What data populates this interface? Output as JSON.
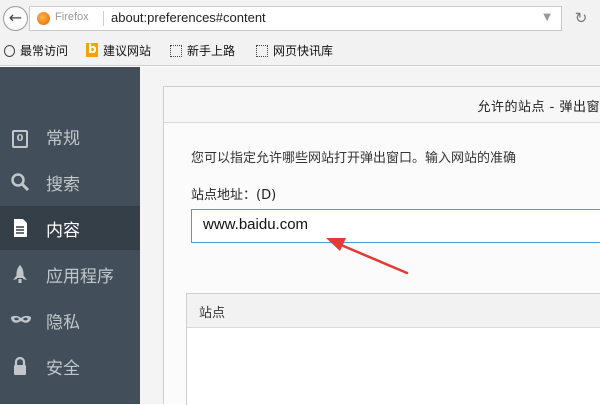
{
  "browser": {
    "brand_label": "Firefox",
    "url": "about:preferences#content"
  },
  "bookmarks": [
    {
      "label": "最常访问",
      "icon": "gear-icon"
    },
    {
      "label": "建议网站",
      "icon": "bing-icon"
    },
    {
      "label": "新手上路",
      "icon": "page-icon"
    },
    {
      "label": "网页快讯库",
      "icon": "page-icon"
    }
  ],
  "sidebar": {
    "items": [
      {
        "label": "常规",
        "icon": "general-icon",
        "selected": false
      },
      {
        "label": "搜索",
        "icon": "search-icon",
        "selected": false
      },
      {
        "label": "内容",
        "icon": "content-icon",
        "selected": true
      },
      {
        "label": "应用程序",
        "icon": "rocket-icon",
        "selected": false
      },
      {
        "label": "隐私",
        "icon": "mask-icon",
        "selected": false
      },
      {
        "label": "安全",
        "icon": "lock-icon",
        "selected": false
      }
    ]
  },
  "dialog": {
    "title": "允许的站点 - 弹出窗",
    "description": "您可以指定允许哪些网站打开弹出窗口。输入网站的准确",
    "field_label": "站点地址：(D)",
    "site_value": "www.baidu.com",
    "list_header": "站点"
  },
  "colors": {
    "sidebar_bg": "#424f5a",
    "sidebar_selected": "#343f48",
    "input_focus": "#3d9de0",
    "annotation_arrow": "#e53935"
  }
}
